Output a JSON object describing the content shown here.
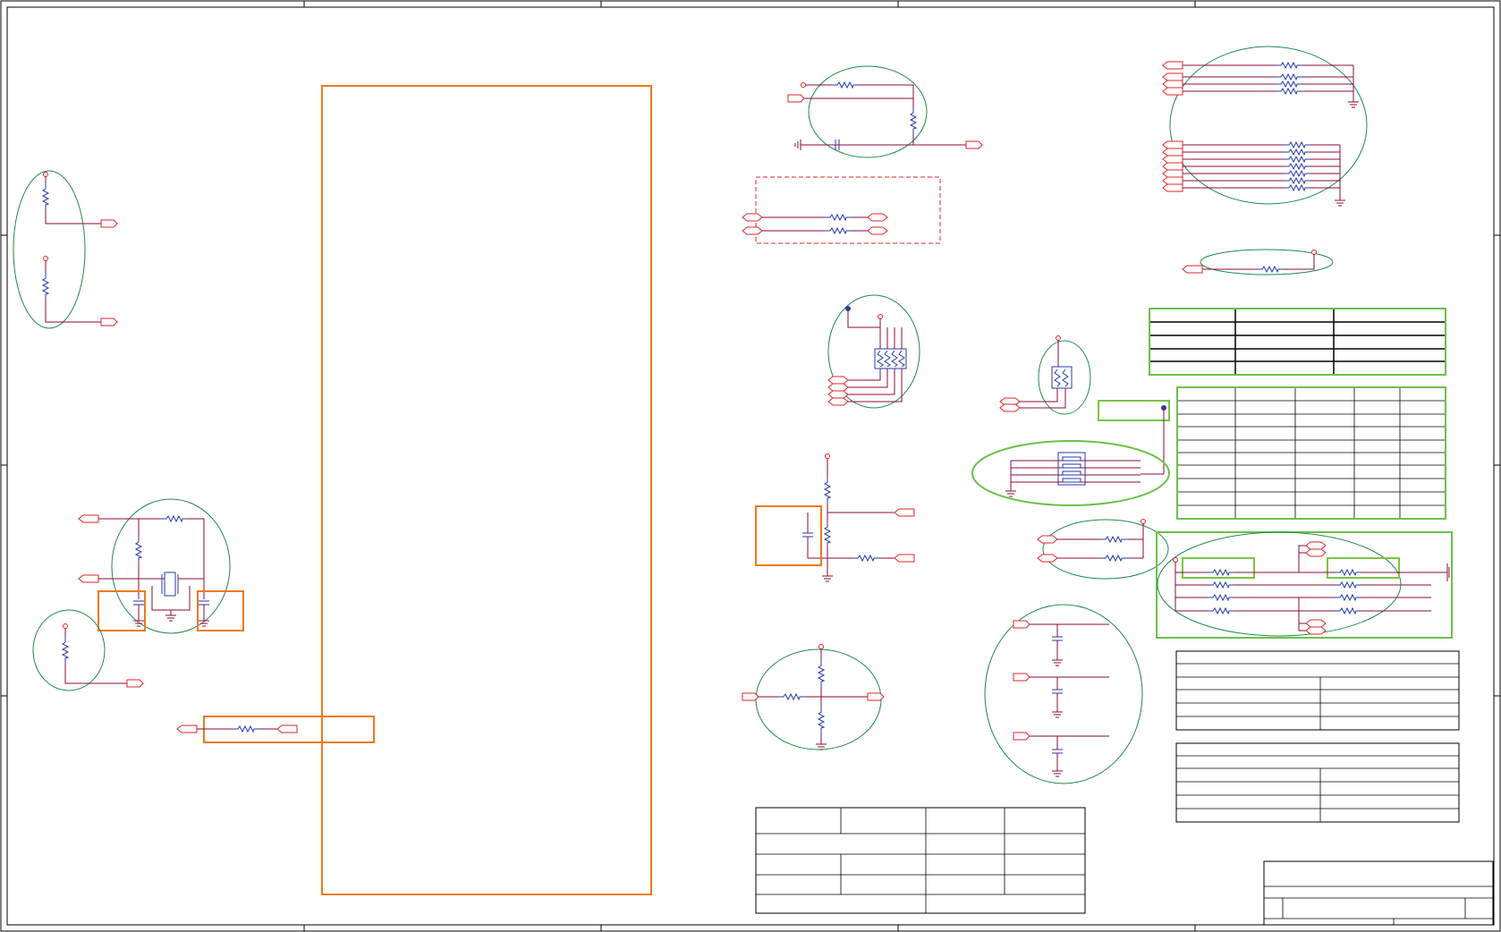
{
  "colors": {
    "frame": "#000000",
    "wire": "#8b0a3c",
    "port": "#e0242a",
    "component": "#2a3aa8",
    "group_ellipse": "#1f8a4a",
    "highlight_orange": "#f07a1a",
    "highlight_green": "#7cc442",
    "dashed_box": "#e0242a",
    "table_green": "#6cc04a"
  },
  "icons": [
    "resistor-icon",
    "capacitor-icon",
    "crystal-icon",
    "ground-icon",
    "power-pin-icon",
    "net-port-icon",
    "junction-dot-icon",
    "resistor-network-icon"
  ]
}
